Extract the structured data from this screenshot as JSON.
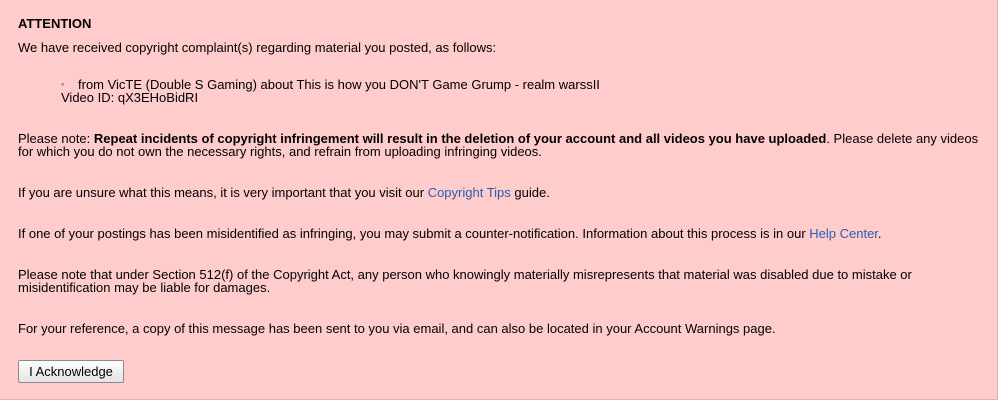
{
  "notice": {
    "title": "ATTENTION",
    "intro": "We have received copyright complaint(s) regarding material you posted, as follows:",
    "complaint": {
      "bullet": "◦",
      "line": "from VicTE (Double S Gaming) about This is how you DON'T Game Grump - realm warssII",
      "video_id": "Video ID: qX3EHoBidRI"
    },
    "repeat_note": {
      "prefix": "Please note: ",
      "bold": "Repeat incidents of copyright infringement will result in the deletion of your account and all videos you have uploaded",
      "suffix": ". Please delete any videos for which you do not own the necessary rights, and refrain from uploading infringing videos."
    },
    "tips": {
      "prefix": "If you are unsure what this means, it is very important that you visit our ",
      "link": "Copyright Tips",
      "suffix": " guide."
    },
    "counter": {
      "prefix": "If one of your postings has been misidentified as infringing, you may submit a counter-notification. Information about this process is in our ",
      "link": "Help Center",
      "suffix": "."
    },
    "section512": "Please note that under Section 512(f) of the Copyright Act, any person who knowingly materially misrepresents that material was disabled due to mistake or misidentification may be liable for damages.",
    "reference": "For your reference, a copy of this message has been sent to you via email, and can also be located in your Account Warnings page.",
    "acknowledge_label": "I Acknowledge"
  },
  "colors": {
    "background": "#ffcccc",
    "link": "#2a5db0"
  }
}
